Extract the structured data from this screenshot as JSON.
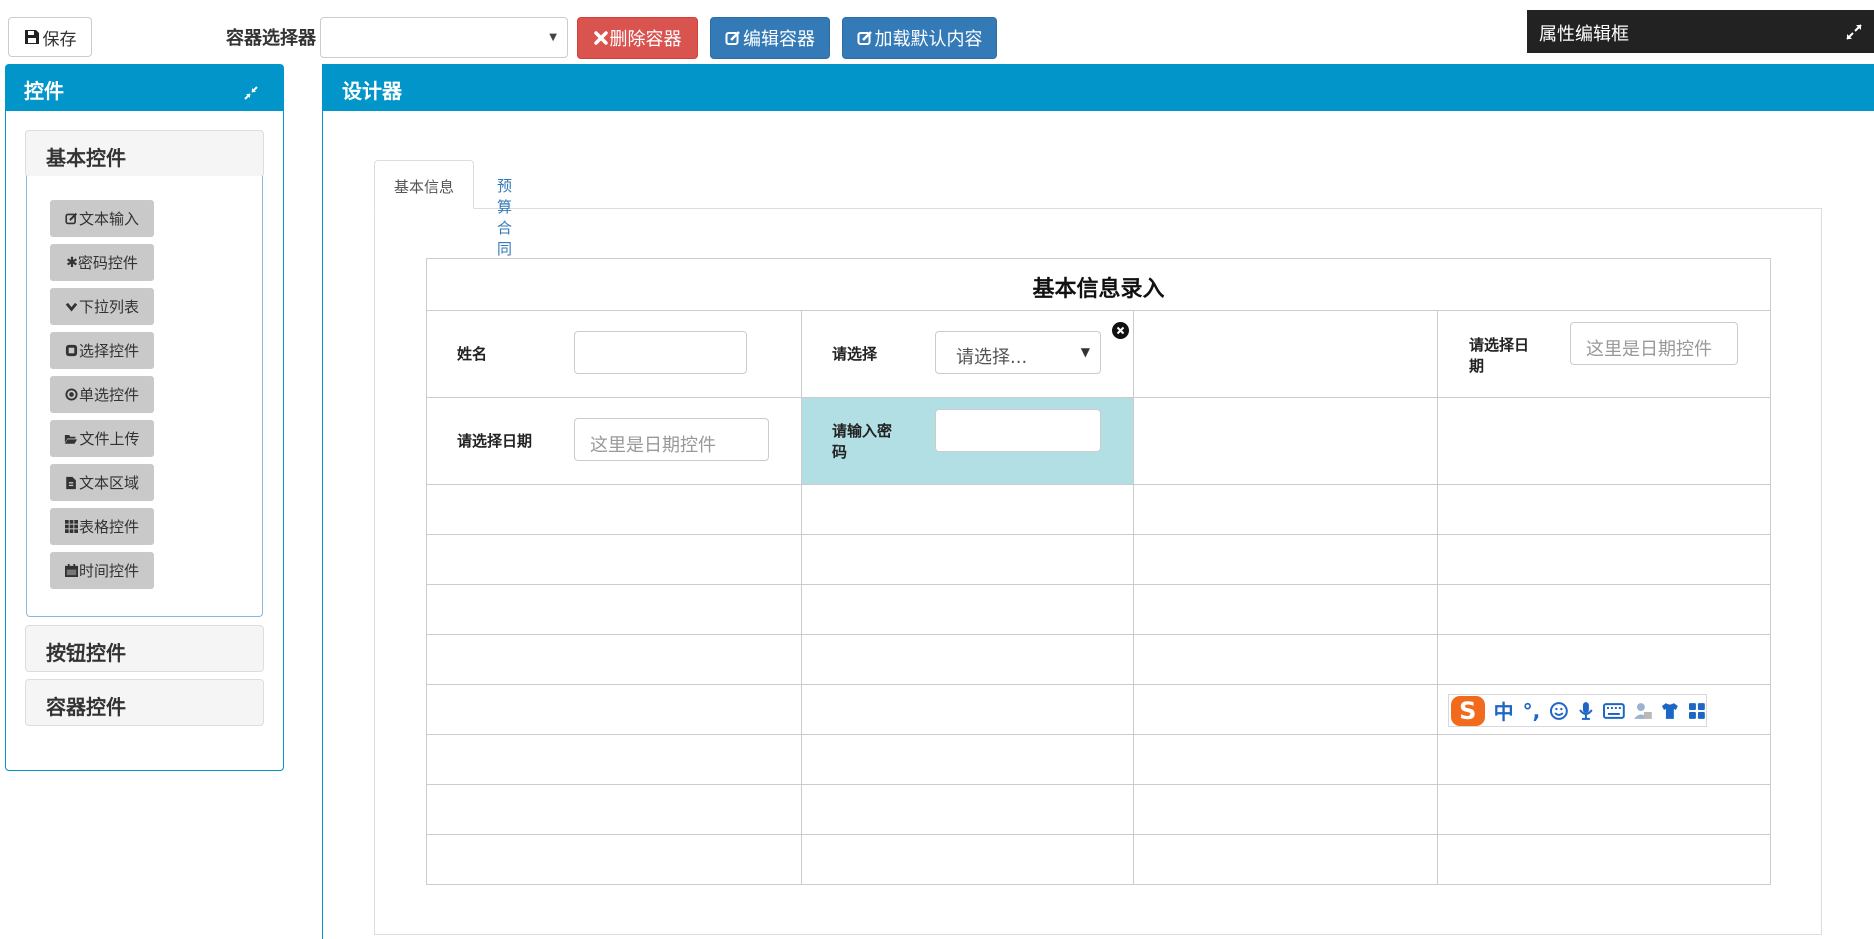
{
  "toolbar": {
    "save_label": "保存",
    "container_selector_label": "容器选择器",
    "container_select_value": "",
    "delete_label": "删除容器",
    "edit_label": "编辑容器",
    "load_default_label": "加载默认内容"
  },
  "property_panel": {
    "title": "属性编辑框"
  },
  "left_panel": {
    "title": "控件",
    "groups": [
      {
        "label": "基本控件",
        "items": [
          {
            "label": "文本输入",
            "icon": "edit-icon"
          },
          {
            "label": "密码控件",
            "icon": "asterisk-icon"
          },
          {
            "label": "下拉列表",
            "icon": "chevron-down-icon"
          },
          {
            "label": "选择控件",
            "icon": "checkbox-icon"
          },
          {
            "label": "单选控件",
            "icon": "radio-icon"
          },
          {
            "label": "文件上传",
            "icon": "folder-open-icon"
          },
          {
            "label": "文本区域",
            "icon": "file-icon"
          },
          {
            "label": "表格控件",
            "icon": "grid-icon"
          },
          {
            "label": "时间控件",
            "icon": "calendar-icon"
          }
        ]
      },
      {
        "label": "按钮控件"
      },
      {
        "label": "容器控件"
      }
    ]
  },
  "designer": {
    "title": "设计器",
    "tabs": [
      {
        "label": "基本信息",
        "active": true
      },
      {
        "label": "预算合同",
        "active": false
      }
    ],
    "form": {
      "title": "基本信息录入",
      "name_label": "姓名",
      "name_value": "",
      "select_label": "请选择",
      "select_placeholder": "请选择...",
      "date_label_1": "请选择日期",
      "date_placeholder_1": "这里是日期控件",
      "date_label_2": "请选择日期",
      "date_placeholder_2": "这里是日期控件",
      "password_label": "请输入密码",
      "password_value": ""
    }
  },
  "ime_toolbar": {
    "logo": "S",
    "mode": "中",
    "punct": "°,"
  },
  "colors": {
    "primary_header": "#0195c9",
    "danger_button": "#d9534f",
    "primary_button": "#337ab7",
    "highlight_cell": "#b2dfe3",
    "property_bar": "#222222"
  }
}
